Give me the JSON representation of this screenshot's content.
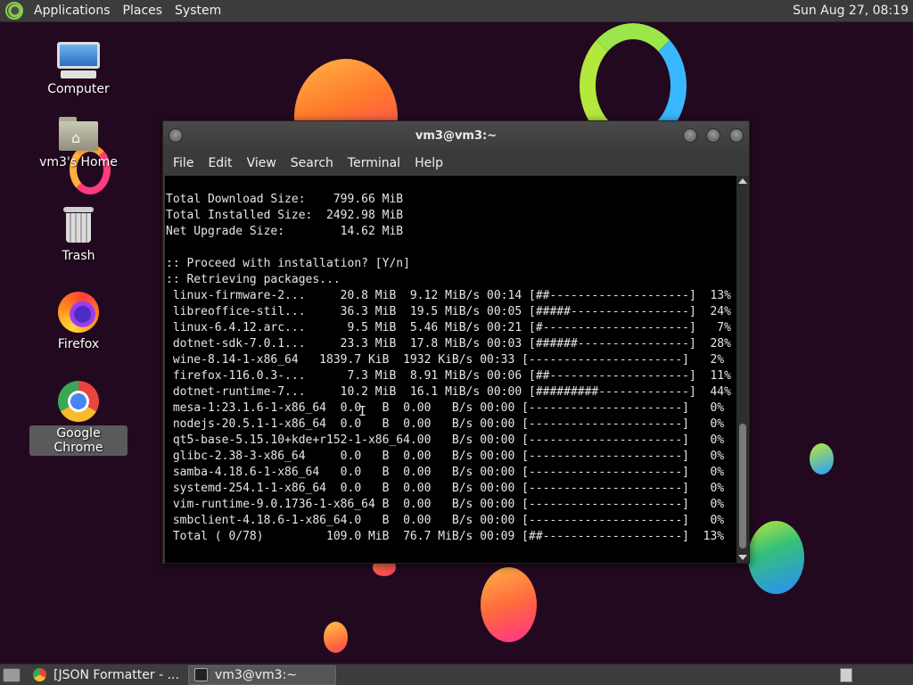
{
  "top_panel": {
    "menus": [
      "Applications",
      "Places",
      "System"
    ],
    "clock": "Sun Aug 27, 08:19"
  },
  "desktop_icons": [
    {
      "label": "Computer",
      "icon": "computer-icon"
    },
    {
      "label": "vm3's Home",
      "icon": "home-folder-icon"
    },
    {
      "label": "Trash",
      "icon": "trash-icon"
    },
    {
      "label": "Firefox",
      "icon": "firefox-icon"
    },
    {
      "label": "Google Chrome",
      "icon": "chrome-icon",
      "selected": true
    }
  ],
  "terminal": {
    "title": "vm3@vm3:~",
    "menus": [
      "File",
      "Edit",
      "View",
      "Search",
      "Terminal",
      "Help"
    ],
    "lines": [
      "Total Download Size:    799.66 MiB",
      "Total Installed Size:  2492.98 MiB",
      "Net Upgrade Size:        14.62 MiB",
      "",
      ":: Proceed with installation? [Y/n]",
      ":: Retrieving packages...",
      " linux-firmware-2...     20.8 MiB  9.12 MiB/s 00:14 [##--------------------]  13%",
      " libreoffice-stil...     36.3 MiB  19.5 MiB/s 00:05 [#####-----------------]  24%",
      " linux-6.4.12.arc...      9.5 MiB  5.46 MiB/s 00:21 [#---------------------]   7%",
      " dotnet-sdk-7.0.1...     23.3 MiB  17.8 MiB/s 00:03 [######----------------]  28%",
      " wine-8.14-1-x86_64   1839.7 KiB  1932 KiB/s 00:33 [----------------------]   2%",
      " firefox-116.0.3-...      7.3 MiB  8.91 MiB/s 00:06 [##--------------------]  11%",
      " dotnet-runtime-7...     10.2 MiB  16.1 MiB/s 00:00 [#########-------------]  44%",
      " mesa-1:23.1.6-1-x86_64  0.0   B  0.00   B/s 00:00 [----------------------]   0%",
      " nodejs-20.5.1-1-x86_64  0.0   B  0.00   B/s 00:00 [----------------------]   0%",
      " qt5-base-5.15.10+kde+r152-1-x86_64.00   B/s 00:00 [----------------------]   0%",
      " glibc-2.38-3-x86_64     0.0   B  0.00   B/s 00:00 [----------------------]   0%",
      " samba-4.18.6-1-x86_64   0.0   B  0.00   B/s 00:00 [----------------------]   0%",
      " systemd-254.1-1-x86_64  0.0   B  0.00   B/s 00:00 [----------------------]   0%",
      " vim-runtime-9.0.1736-1-x86_64 B  0.00   B/s 00:00 [----------------------]   0%",
      " smbclient-4.18.6-1-x86_64.0   B  0.00   B/s 00:00 [----------------------]   0%",
      " Total ( 0/78)         109.0 MiB  76.7 MiB/s 00:09 [##--------------------]  13%"
    ]
  },
  "taskbar": {
    "tasks": [
      {
        "label": "[JSON Formatter - ...",
        "icon": "chrome-icon",
        "active": false
      },
      {
        "label": "vm3@vm3:~",
        "icon": "terminal-icon",
        "active": true
      }
    ]
  }
}
